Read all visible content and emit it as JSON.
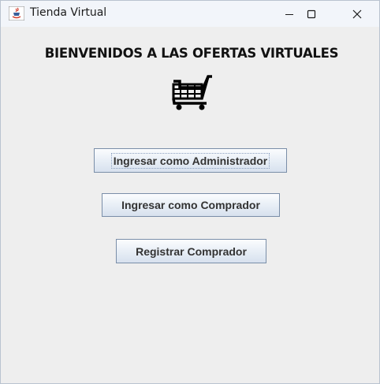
{
  "window": {
    "title": "Tienda Virtual",
    "icons": {
      "app": "java-cup-icon",
      "minimize": "minimize-icon",
      "maximize": "maximize-icon",
      "close": "close-icon"
    }
  },
  "main": {
    "heading": "BIENVENIDOS A LAS OFERTAS VIRTUALES",
    "icon": "shopping-cart-icon",
    "buttons": {
      "admin_login": "Ingresar como Administrador",
      "buyer_login": "Ingresar como Comprador",
      "register_buyer": "Registrar Comprador"
    }
  },
  "colors": {
    "background": "#eeeeee",
    "titlebar": "#f2f5fa",
    "button_border": "#7a8ea8"
  }
}
